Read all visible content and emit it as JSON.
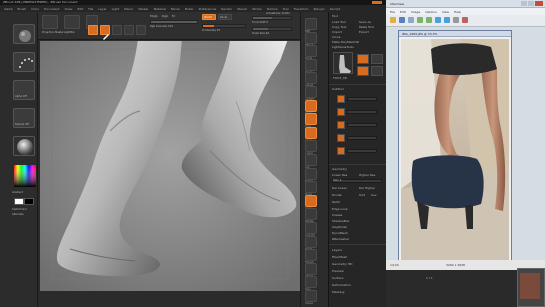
{
  "zbrush": {
    "title": "ZBrush 4R6 [UNREGISTERED] - ZBrush Document",
    "menu": [
      "Alpha",
      "Brush",
      "Color",
      "Document",
      "Draw",
      "Edit",
      "File",
      "Layer",
      "Light",
      "Macro",
      "Marker",
      "Material",
      "Movie",
      "Picker",
      "Preferences",
      "Render",
      "Stencil",
      "Stroke",
      "Texture",
      "Tool",
      "Transform",
      "Zplugin",
      "Zscript"
    ],
    "shelf": {
      "edit_label": "Edit",
      "draw_label": "Draw",
      "move_label": "Move",
      "scale_label": "Scale",
      "rotate_label": "Rotate",
      "mrgb_label": "Mrgb",
      "rgb_label": "Rgb",
      "m_label": "M",
      "zadd_label": "Zadd",
      "zsub_label": "Zsub",
      "rgb_intensity": "Rgb Intensity 100",
      "z_intensity": "Z Intensity 25",
      "focal_shift": "Focal Shift 0",
      "draw_size": "Draw Size 64",
      "dynamic_label": "Dynamic",
      "lightbox_label": "LightBox",
      "projection_label": "Projection Master",
      "quicksketch_label": "Quick Sketch",
      "active_points": "ActivePoints: 34,902",
      "total_points": "TotalPoints: 1.24 Mil"
    },
    "canvas_color": "#8b8b8b",
    "accent": "#d86b1f",
    "right_shelf_labels": [
      "BPR",
      "SPix 3",
      "Scroll",
      "Zoom",
      "Actual",
      "AAHalf",
      "Persp",
      "Floor",
      "Local",
      "L.Sym",
      "Xyz",
      "Frame",
      "Move",
      "Scale",
      "Rotate",
      "Line Fill",
      "PolyF",
      "Transp",
      "Ghost",
      "Solo",
      "Xpose"
    ],
    "palette": {
      "header": "Tool",
      "load_tool": "Load Tool",
      "save_as": "Save As",
      "copy_tool": "Copy Tool",
      "paste_tool": "Paste Tool",
      "import": "Import",
      "export": "Export",
      "clone": "Clone",
      "make_polymesh": "Make PolyMesh3D",
      "goz": "GoZ",
      "all": "All",
      "visible": "Visible",
      "lightbox_tools": "Lightbox▸Tools",
      "current_tool": "FOOT_48",
      "subtool": "SubTool",
      "geometry": "Geometry",
      "lower_res": "Lower Res",
      "higher_res": "Higher Res",
      "sdiv": "SDiv 3",
      "del_lower": "Del Lower",
      "del_higher": "Del Higher",
      "divide": "Divide",
      "smt": "Smt",
      "suv": "Suv",
      "reproject": "ReUV",
      "edge_loop": "Edge Loop",
      "crease": "Crease",
      "shadowbox": "ShadowBox",
      "claypolish": "ClayPolish",
      "dynamesh": "DynaMesh",
      "zremesher": "ZRemesher",
      "layers": "Layers",
      "fibermesh": "FiberMesh",
      "geometry_hd": "Geometry HD",
      "preview": "Preview",
      "surface": "Surface",
      "deformation": "Deformation",
      "masking": "Masking"
    },
    "left_shelf": {
      "alpha_label": "Alpha Off",
      "texture_label": "Texture Off",
      "material_label": "MatCap Gray",
      "gradient_label": "Gradient",
      "switch_color": "SwitchColor",
      "alternate": "Alternate",
      "primary_color": "#ffffff",
      "secondary_color": "#000000"
    }
  },
  "viewer": {
    "title": "IrfanView",
    "menu": [
      "File",
      "Edit",
      "Image",
      "Options",
      "View",
      "Help"
    ],
    "window_title": "IMG_1084.JPG @ 33.3%",
    "status_left": "1/124",
    "status_right": "3264 x 4928",
    "bottom_label": "1 / 1"
  }
}
